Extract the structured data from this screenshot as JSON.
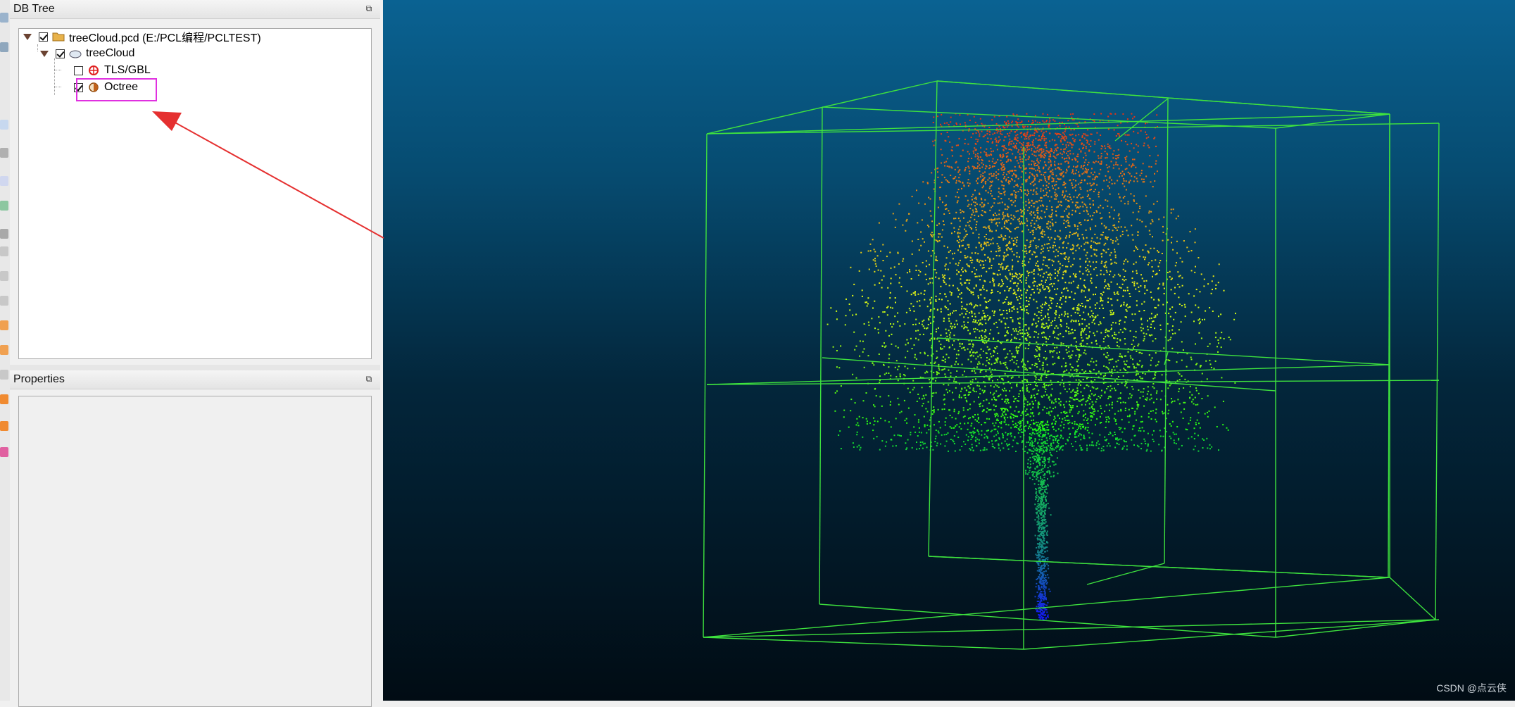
{
  "db_tree": {
    "title": "DB Tree",
    "items": [
      {
        "label": "treeCloud.pcd (E:/PCL编程/PCLTEST)",
        "checked": true,
        "icon": "folder-icon"
      },
      {
        "label": "treeCloud",
        "checked": true,
        "icon": "cloud-icon"
      },
      {
        "label": "TLS/GBL",
        "checked": false,
        "icon": "target-icon"
      },
      {
        "label": "Octree",
        "checked": true,
        "icon": "octree-icon"
      }
    ]
  },
  "properties": {
    "title": "Properties"
  },
  "viewer": {
    "watermark": "CSDN @点云侠",
    "background_top": "#0a6292",
    "background_bottom": "#010c14",
    "octree_color": "#3ee23e"
  },
  "annotations": {
    "highlight_color": "#e030e0",
    "arrow_color": "#e53030"
  }
}
